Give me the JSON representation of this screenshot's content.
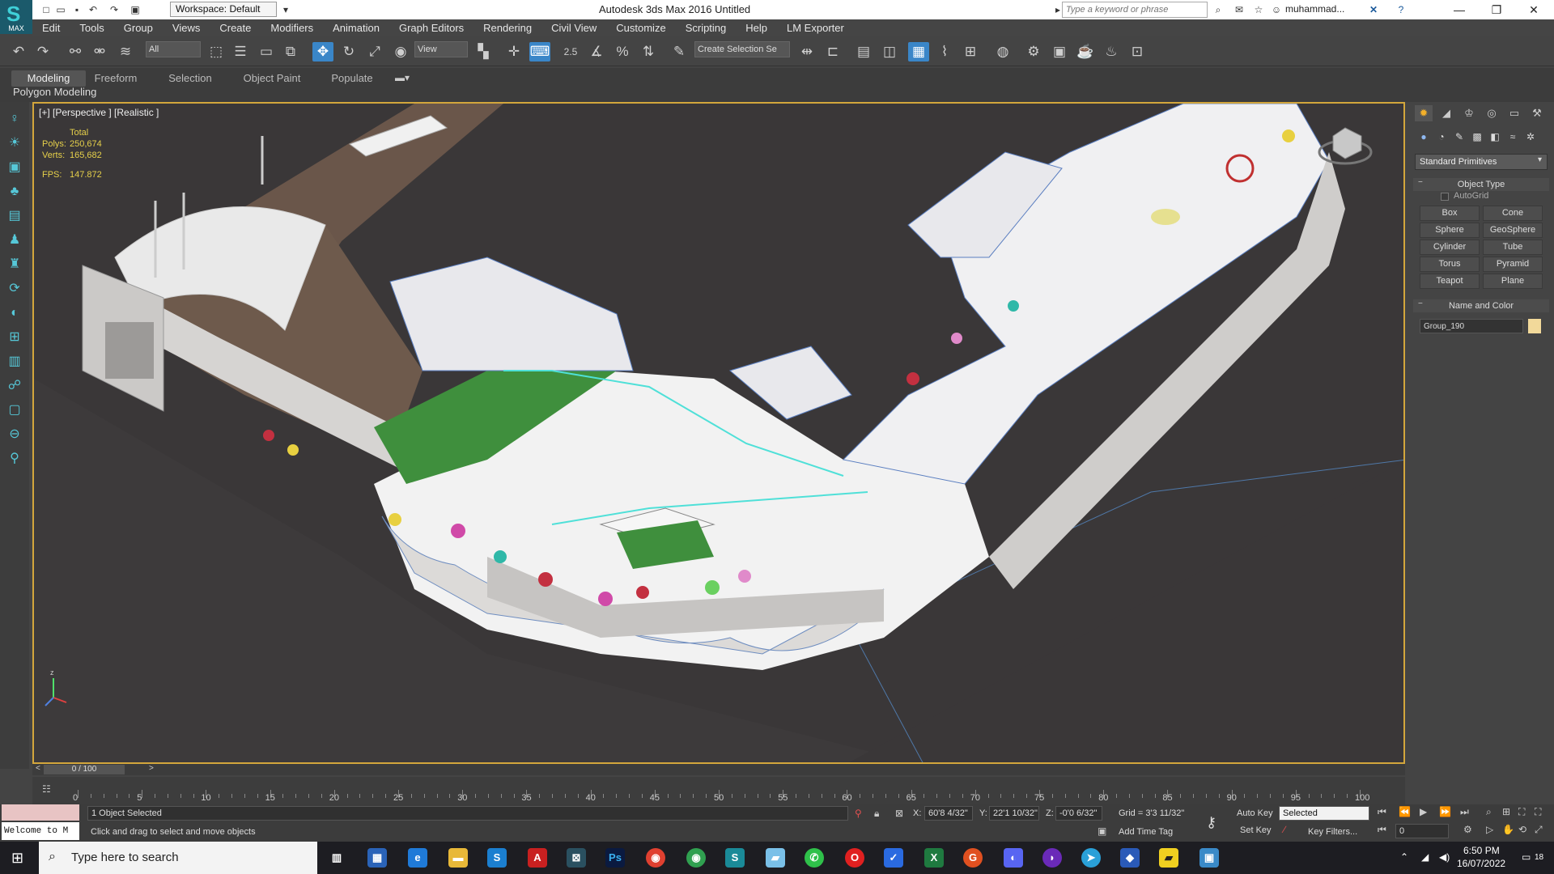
{
  "titlebar": {
    "workspace": "Workspace: Default",
    "app_title": "Autodesk 3ds Max 2016   Untitled",
    "search_placeholder": "Type a keyword or phrase",
    "user": "muhammad..."
  },
  "menu": [
    "Edit",
    "Tools",
    "Group",
    "Views",
    "Create",
    "Modifiers",
    "Animation",
    "Graph Editors",
    "Rendering",
    "Civil View",
    "Customize",
    "Scripting",
    "Help",
    "LM Exporter"
  ],
  "toolbar": {
    "filter": "All",
    "ref_coord": "View",
    "selection_set": "Create Selection Se",
    "snap_label": "2.5"
  },
  "ribbon": {
    "tabs": [
      "Modeling",
      "Freeform",
      "Selection",
      "Object Paint",
      "Populate"
    ],
    "sub": "Polygon Modeling"
  },
  "viewport": {
    "label": "[+] [Perspective ] [Realistic ]",
    "stats_header": "Total",
    "polys_label": "Polys:",
    "polys": "250,674",
    "verts_label": "Verts:",
    "verts": "165,682",
    "fps_label": "FPS:",
    "fps": "147.872"
  },
  "command_panel": {
    "dropdown": "Standard Primitives",
    "object_type": "Object Type",
    "autogrid": "AutoGrid",
    "primitives": [
      "Box",
      "Cone",
      "Sphere",
      "GeoSphere",
      "Cylinder",
      "Tube",
      "Torus",
      "Pyramid",
      "Teapot",
      "Plane"
    ],
    "name_and_color": "Name and Color",
    "object_name": "Group_190",
    "swatch_color": "#f2d99a"
  },
  "timeline": {
    "frame": "0 / 100",
    "ticks": [
      "0",
      "5",
      "10",
      "15",
      "20",
      "25",
      "30",
      "35",
      "40",
      "45",
      "50",
      "55",
      "60",
      "65",
      "70",
      "75",
      "80",
      "85",
      "90",
      "95",
      "100"
    ]
  },
  "status": {
    "listener": "Welcome to M",
    "selected": "1 Object Selected",
    "prompt": "Click and drag to select and move objects",
    "x": "60'8 4/32\"",
    "y": "22'1 10/32\"",
    "z": "-0'0 6/32\"",
    "grid": "Grid = 3'3 11/32\"",
    "auto_key": "Auto Key",
    "key_mode": "Selected",
    "set_key": "Set Key",
    "key_filters": "Key Filters...",
    "add_time_tag": "Add Time Tag",
    "frame_field": "0"
  },
  "taskbar": {
    "search": "Type here to search",
    "time": "6:50 PM",
    "date": "16/07/2022",
    "notifications": "18"
  }
}
